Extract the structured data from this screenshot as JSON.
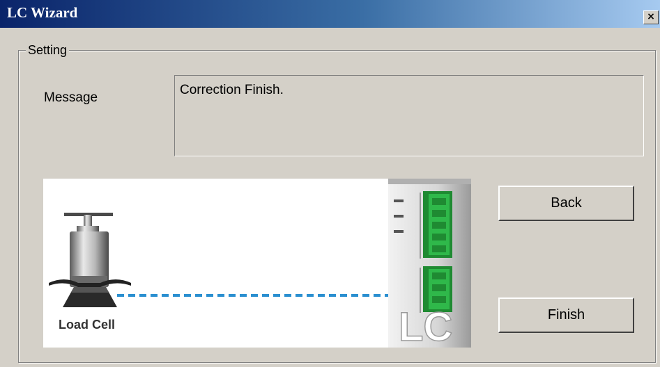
{
  "window": {
    "title": "LC Wizard",
    "close_glyph": "×"
  },
  "setting": {
    "group_label": "Setting",
    "message_label": "Message",
    "message_text": "Correction Finish."
  },
  "illustration": {
    "load_cell_label": "Load Cell",
    "module_text": "LC",
    "connector_color": "#2fb84a",
    "cable_color": "#2a8fd0"
  },
  "buttons": {
    "back": "Back",
    "finish": "Finish"
  }
}
